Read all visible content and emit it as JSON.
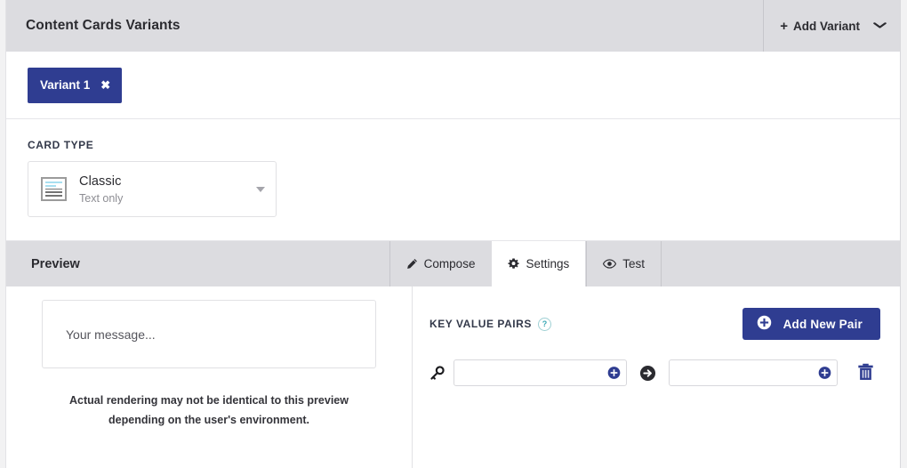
{
  "header": {
    "title": "Content Cards Variants",
    "add_variant_label": "Add Variant",
    "add_variant_plus": "+",
    "caret_glyph": "˅"
  },
  "variants": {
    "chips": [
      {
        "label": "Variant 1",
        "close_glyph": "✖"
      }
    ]
  },
  "card_type": {
    "section_label": "CARD TYPE",
    "selected": {
      "name": "Classic",
      "subtitle": "Text only",
      "icon": "classic-card-icon"
    }
  },
  "preview_bar": {
    "title": "Preview",
    "tabs": [
      {
        "label": "Compose",
        "icon": "pencil-icon",
        "active": false
      },
      {
        "label": "Settings",
        "icon": "gear-icon",
        "active": true
      },
      {
        "label": "Test",
        "icon": "eye-icon",
        "active": false
      }
    ]
  },
  "preview": {
    "message_placeholder": "Your message...",
    "note_line_1": "Actual rendering may not be identical to this preview depending on",
    "note_line_2": "the user's environment.",
    "note_full": "Actual rendering may not be identical to this preview depending on the user's environment."
  },
  "settings": {
    "kvp_title": "KEY VALUE PAIRS",
    "help_glyph": "?",
    "add_new_pair_label": "Add New Pair",
    "rows": [
      {
        "key_icon": "key-icon",
        "key_value": "",
        "key_placeholder": "",
        "arrow_icon": "arrow-right-circle-icon",
        "value_value": "",
        "value_placeholder": "",
        "delete_icon": "trash-icon"
      }
    ]
  },
  "colors": {
    "brand_navy": "#2f3d91",
    "header_gray": "#dcdce0",
    "page_white": "#ffffff",
    "border_gray": "#e2e2e5",
    "help_teal": "#3aa8b4",
    "icon_blue_light": "#a8dff0"
  }
}
